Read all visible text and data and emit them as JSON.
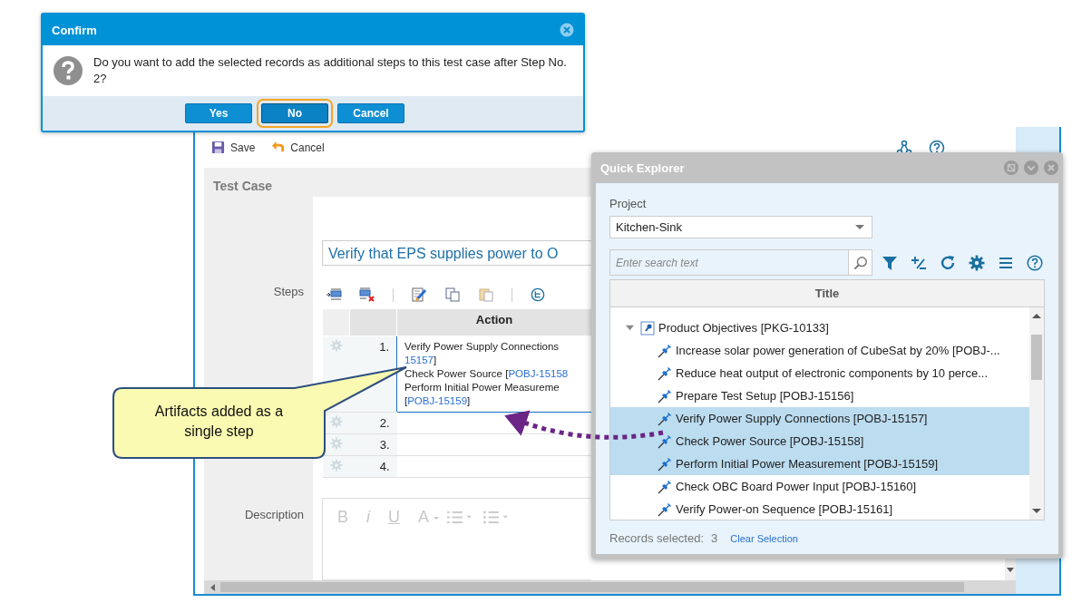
{
  "test_case_window": {
    "toolbar": [
      {
        "kind": "save",
        "label": "Save"
      },
      {
        "kind": "cancel",
        "label": "Cancel"
      }
    ],
    "heading": "Test Case",
    "name_value": "Verify that EPS supplies power to O",
    "steps_label": "Steps",
    "steps_table": {
      "columns": [
        "Action"
      ],
      "rows": [
        {
          "number": "1.",
          "selected": true,
          "lines": [
            [
              {
                "text": "Verify Power Supply Connections",
                "link": false
              }
            ],
            [
              {
                "text": "15157",
                "link": true
              },
              {
                "text": "]",
                "link": false
              }
            ],
            [
              {
                "text": "Check Power Source [",
                "link": false
              },
              {
                "text": "POBJ-15158",
                "link": true
              }
            ],
            [
              {
                "text": "Perform Initial Power Measureme",
                "link": false
              }
            ],
            [
              {
                "text": "[",
                "link": false
              },
              {
                "text": "POBJ-15159",
                "link": true
              },
              {
                "text": "]",
                "link": false
              }
            ]
          ]
        },
        {
          "number": "2.",
          "selected": false,
          "lines": []
        },
        {
          "number": "3.",
          "selected": false,
          "lines": []
        },
        {
          "number": "4.",
          "selected": false,
          "lines": []
        }
      ]
    },
    "description_label": "Description",
    "editor": {
      "disabled": true,
      "tools": [
        {
          "kind": "bold",
          "label": "B"
        },
        {
          "kind": "italic",
          "label": "i"
        },
        {
          "kind": "underline",
          "label": "U"
        },
        {
          "kind": "font-color",
          "label": "A"
        },
        {
          "kind": "numbered-list"
        },
        {
          "kind": "bullet-list"
        }
      ]
    }
  },
  "confirm_dialog": {
    "title": "Confirm",
    "message": "Do you want to add the selected records as additional steps to this test case after Step No. 2?",
    "buttons": [
      {
        "label": "Yes",
        "focused": false
      },
      {
        "label": "No",
        "focused": true
      },
      {
        "label": "Cancel",
        "focused": false
      }
    ]
  },
  "quick_explorer": {
    "title": "Quick Explorer",
    "project_label": "Project",
    "project_value": "Kitchen-Sink",
    "search": {
      "placeholder": "Enter search text"
    },
    "tree_header": "Title",
    "tree": [
      {
        "label": "Product Objectives [PKG-10133]",
        "kind": "folder",
        "expanded": true,
        "selected": false,
        "children": [
          {
            "label": "Increase solar power generation of CubeSat by 20% [POBJ-...",
            "kind": "item",
            "selected": false
          },
          {
            "label": "Reduce heat output of electronic components by 10 perce...",
            "kind": "item",
            "selected": false
          },
          {
            "label": "Prepare Test Setup [POBJ-15156]",
            "kind": "item",
            "selected": false
          },
          {
            "label": "Verify Power Supply Connections [POBJ-15157]",
            "kind": "item",
            "selected": true
          },
          {
            "label": "Check Power Source [POBJ-15158]",
            "kind": "item",
            "selected": true
          },
          {
            "label": "Perform Initial Power Measurement [POBJ-15159]",
            "kind": "item",
            "selected": true
          },
          {
            "label": "Check OBC Board Power Input [POBJ-15160]",
            "kind": "item",
            "selected": false
          },
          {
            "label": "Verify Power-on Sequence [POBJ-15161]",
            "kind": "item",
            "selected": false
          }
        ]
      }
    ],
    "records_label": "Records selected:",
    "records_count": "3",
    "clear_link": "Clear Selection"
  },
  "callout": {
    "text": "Artifacts added as a single step"
  }
}
